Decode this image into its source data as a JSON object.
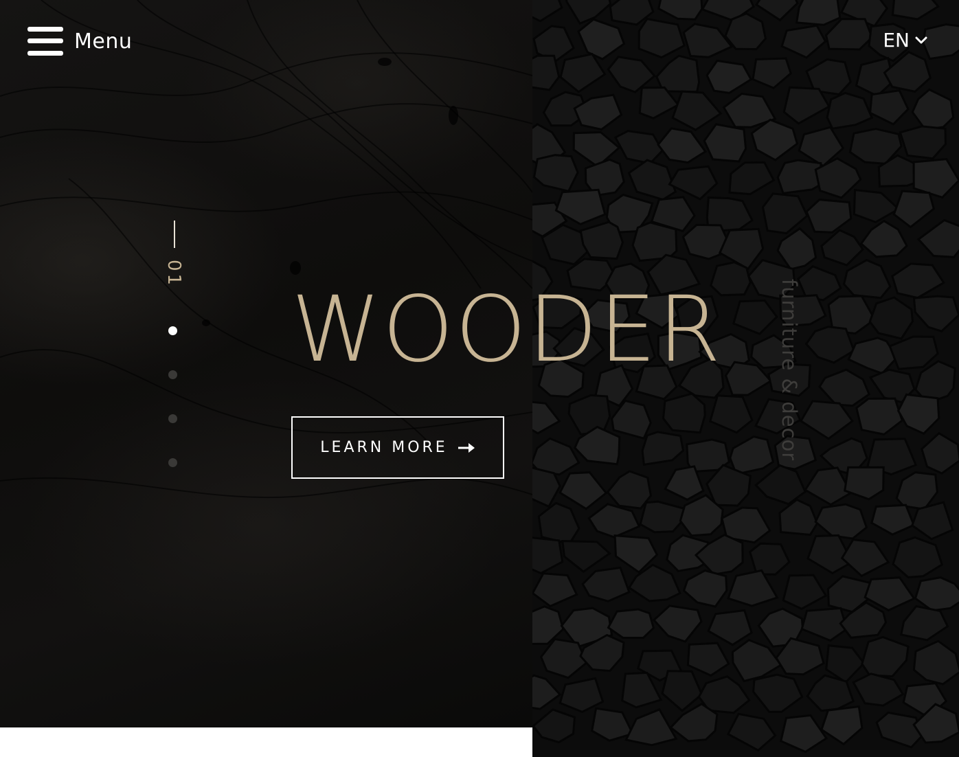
{
  "header": {
    "menu_label": "Menu",
    "language": "EN"
  },
  "slider": {
    "current_number": "01",
    "total_slides": 4,
    "active_index": 0
  },
  "hero": {
    "title": "WOODER",
    "cta_label": "LEARN MORE",
    "tagline": "furniture & decor"
  },
  "icons": {
    "menu": "hamburger-icon",
    "language": "chevron-down-icon",
    "cta": "arrow-right-icon"
  },
  "colors": {
    "accent": "#c7b493",
    "text": "#ffffff",
    "background": "#0b0b0b",
    "inactive_dot": "#3a3937"
  }
}
